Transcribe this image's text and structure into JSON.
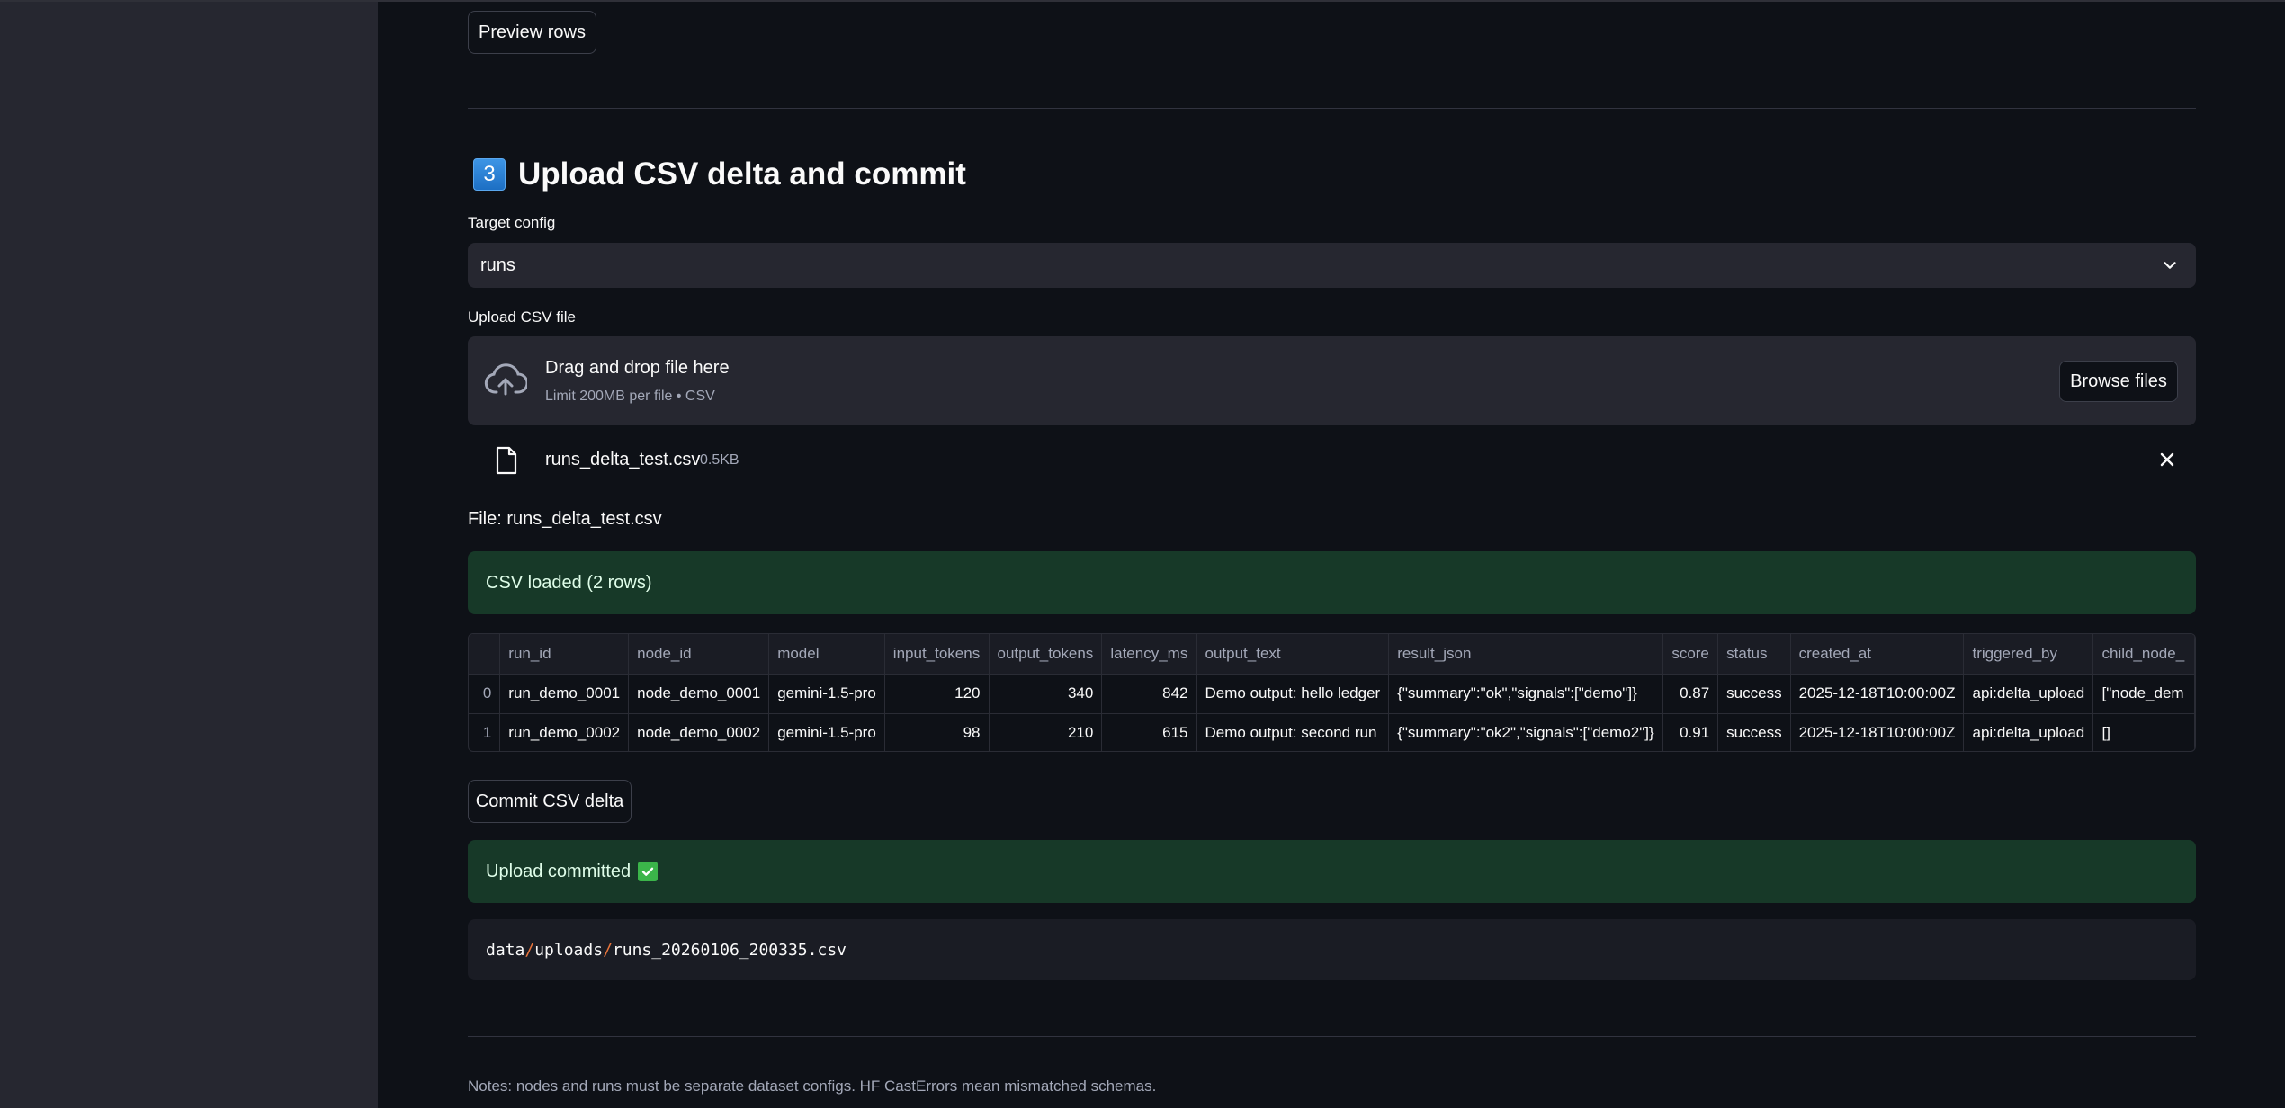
{
  "preview_button": "Preview rows",
  "section": {
    "number": "3",
    "title": "Upload CSV delta and commit"
  },
  "target_config": {
    "label": "Target config",
    "value": "runs"
  },
  "upload": {
    "label": "Upload CSV file",
    "drop_title": "Drag and drop file here",
    "drop_limit": "Limit 200MB per file • CSV",
    "browse_label": "Browse files",
    "file_name": "runs_delta_test.csv",
    "file_size": "0.5KB"
  },
  "file_caption": "File: runs_delta_test.csv",
  "loaded_message": "CSV loaded (2 rows)",
  "table": {
    "columns": [
      "",
      "run_id",
      "node_id",
      "model",
      "input_tokens",
      "output_tokens",
      "latency_ms",
      "output_text",
      "result_json",
      "score",
      "status",
      "created_at",
      "triggered_by",
      "child_node_"
    ],
    "rows": [
      [
        "0",
        "run_demo_0001",
        "node_demo_0001",
        "gemini-1.5-pro",
        "120",
        "340",
        "842",
        "Demo output: hello ledger",
        "{\"summary\":\"ok\",\"signals\":[\"demo\"]}",
        "0.87",
        "success",
        "2025-12-18T10:00:00Z",
        "api:delta_upload",
        "[\"node_dem"
      ],
      [
        "1",
        "run_demo_0002",
        "node_demo_0002",
        "gemini-1.5-pro",
        "98",
        "210",
        "615",
        "Demo output: second run",
        "{\"summary\":\"ok2\",\"signals\":[\"demo2\"]}",
        "0.91",
        "success",
        "2025-12-18T10:00:00Z",
        "api:delta_upload",
        "[]"
      ]
    ]
  },
  "commit_button": "Commit CSV delta",
  "committed_message": "Upload committed",
  "output_path": {
    "parts": [
      "data",
      "uploads",
      "runs_20260106_200335.csv"
    ],
    "separator": "/"
  },
  "notes": "Notes: nodes and runs must be separate dataset configs. HF CastErrors mean mismatched schemas.",
  "colors": {
    "background": "#0e1117",
    "sidebar": "#262730",
    "success_bg": "#173928",
    "accent_path": "#e8743b"
  },
  "icons": {
    "upload": "cloud-upload-icon",
    "file": "file-icon",
    "close": "close-icon",
    "chevron": "chevron-down-icon",
    "check": "check-box-icon"
  }
}
